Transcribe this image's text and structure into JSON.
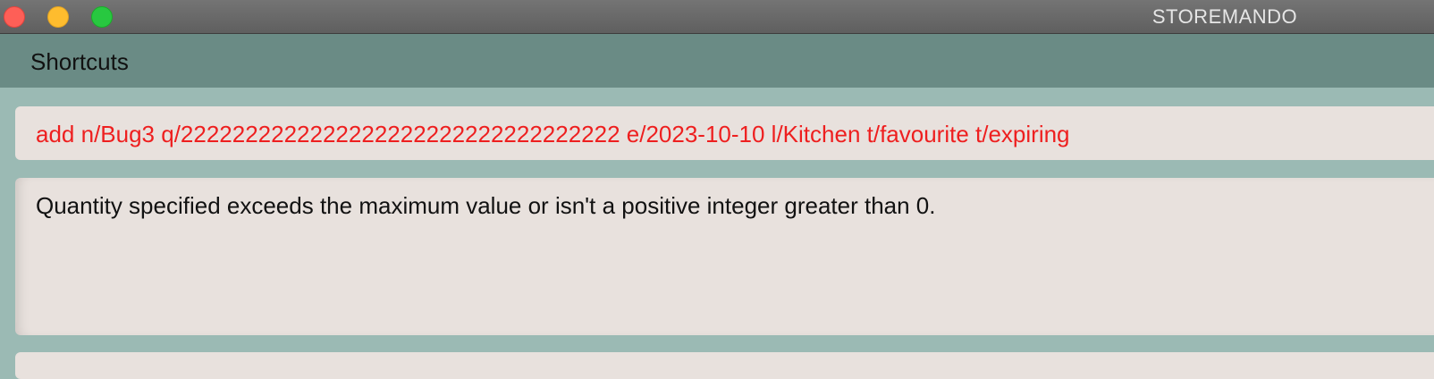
{
  "window": {
    "title": "STOREMANDO",
    "controls": [
      "close",
      "minimize",
      "zoom"
    ]
  },
  "menu": {
    "items": [
      {
        "label": "Shortcuts"
      }
    ]
  },
  "command_box": {
    "value": "add n/Bug3 q/2222222222222222222222222222222222 e/2023-10-10 l/Kitchen t/favourite t/expiring",
    "text_color": "#ee1f1f"
  },
  "result_display": {
    "message": "Quantity specified exceeds the maximum value or isn't a positive integer greater than 0."
  },
  "colors": {
    "background": "#9bbab4",
    "menubar": "#6a8b85",
    "panel": "#e8e1dd",
    "error_text": "#ee1f1f"
  }
}
